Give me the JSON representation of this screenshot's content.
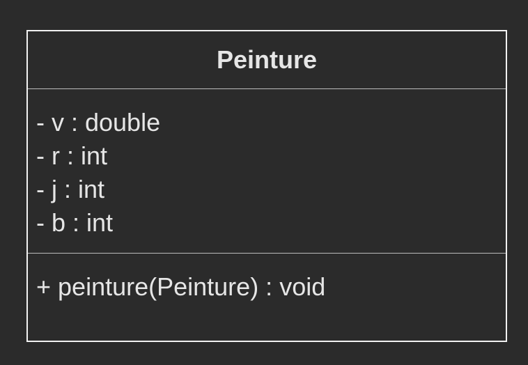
{
  "class": {
    "name": "Peinture",
    "attributes": [
      "- v : double",
      "- r : int",
      "- j : int",
      "- b : int"
    ],
    "operations": [
      "+ peinture(Peinture) : void"
    ]
  },
  "colors": {
    "background": "#2b2b2b",
    "border": "#f2f2f2",
    "text": "#e6e6e6"
  }
}
